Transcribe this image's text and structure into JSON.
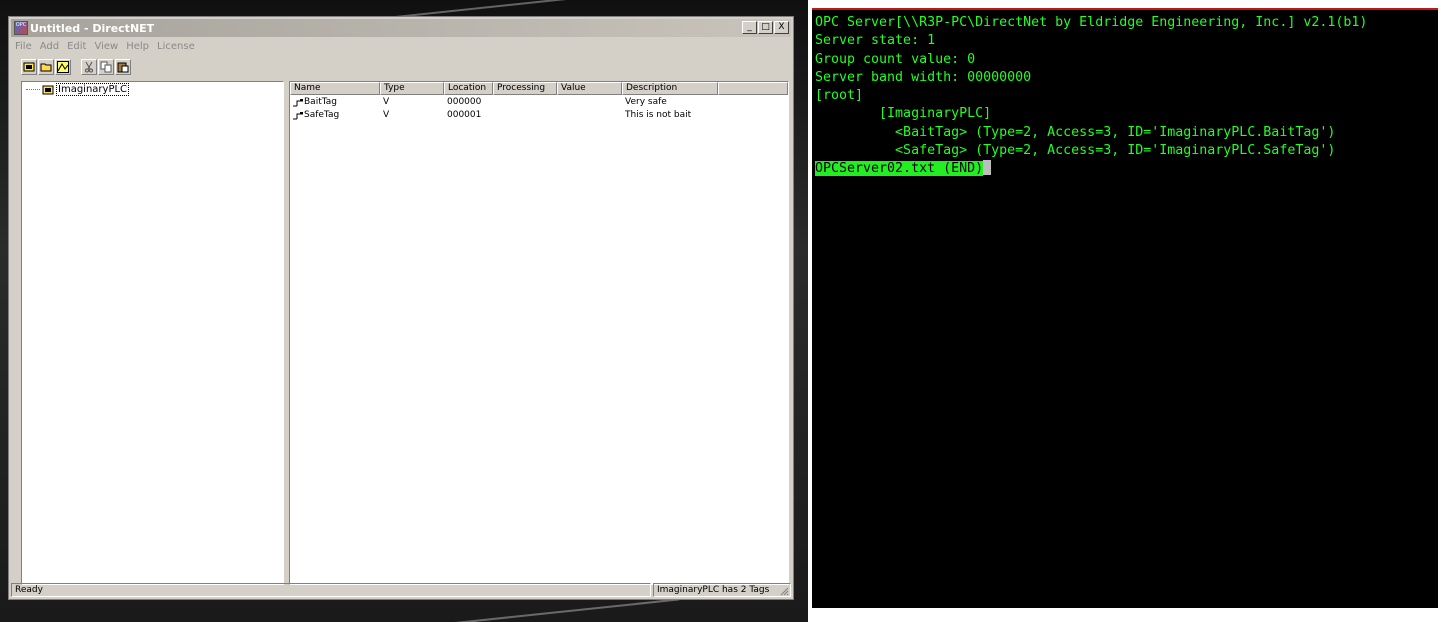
{
  "colors": {
    "terminal_bg": "#000000",
    "terminal_fg": "#22ff22",
    "terminal_highlight": "#22ee22",
    "window_face": "#d4d0c8"
  },
  "window": {
    "title": "Untitled - DirectNET",
    "app_icon": "opc-app-icon",
    "controls": {
      "minimize": "_",
      "maximize": "□",
      "close": "X"
    }
  },
  "menu": [
    "File",
    "Add",
    "Edit",
    "View",
    "Help",
    "License"
  ],
  "toolbar": [
    "new-device-icon",
    "open-icon",
    "trend-icon",
    "cut-icon",
    "copy-icon",
    "paste-icon"
  ],
  "tree": {
    "root_label": "ImaginaryPLC",
    "root_icon": "plc-icon"
  },
  "list": {
    "columns": [
      "Name",
      "Type",
      "Location",
      "Processing",
      "Value",
      "Description"
    ],
    "rows": [
      {
        "name": "BaitTag",
        "type": "V",
        "location": "000000",
        "processing": "",
        "value": "",
        "description": "Very safe"
      },
      {
        "name": "SafeTag",
        "type": "V",
        "location": "000001",
        "processing": "",
        "value": "",
        "description": "This is not bait"
      }
    ]
  },
  "status": {
    "left": "Ready",
    "right": "ImaginaryPLC has 2 Tags"
  },
  "terminal": {
    "lines": [
      "OPC Server[\\\\R3P-PC\\DirectNet by Eldridge Engineering, Inc.] v2.1(b1)",
      "Server state: 1",
      "Group count value: 0",
      "Server band width: 00000000",
      "[root]",
      "        [ImaginaryPLC]",
      "          <BaitTag> (Type=2, Access=3, ID='ImaginaryPLC.BaitTag')",
      "          <SafeTag> (Type=2, Access=3, ID='ImaginaryPLC.SafeTag')"
    ],
    "footer": "OPCServer02.txt (END)"
  }
}
